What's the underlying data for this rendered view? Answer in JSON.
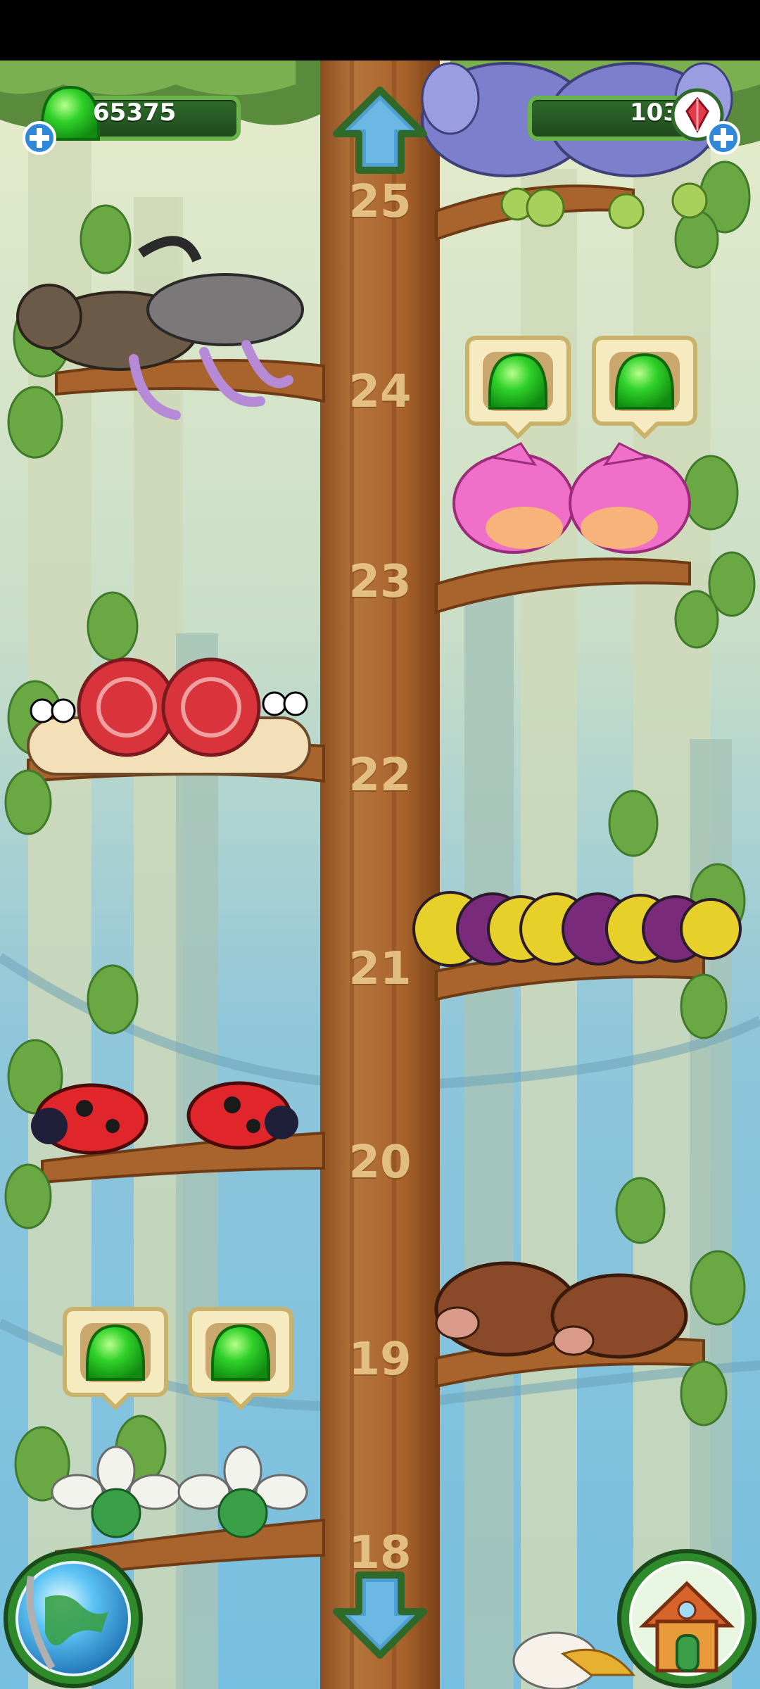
{
  "hud": {
    "currency_left": "65375",
    "currency_right": "103"
  },
  "tree": {
    "levels": [
      "25",
      "24",
      "23",
      "22",
      "21",
      "20",
      "19",
      "18"
    ]
  },
  "icons": {
    "nav_up": "arrow-up-icon",
    "nav_down": "arrow-down-icon",
    "globe_button": "globe-icon",
    "home_button": "house-icon",
    "add_left": "plus-icon",
    "add_right": "plus-icon",
    "jelly": "green-jelly-icon",
    "gem": "red-crystal-icon"
  },
  "colors": {
    "sky": "#9dd1e6",
    "trunk": "#b06a32",
    "leaf": "#6aa843",
    "hud_green": "#2f6a2b",
    "jelly_green": "#39c12c"
  }
}
